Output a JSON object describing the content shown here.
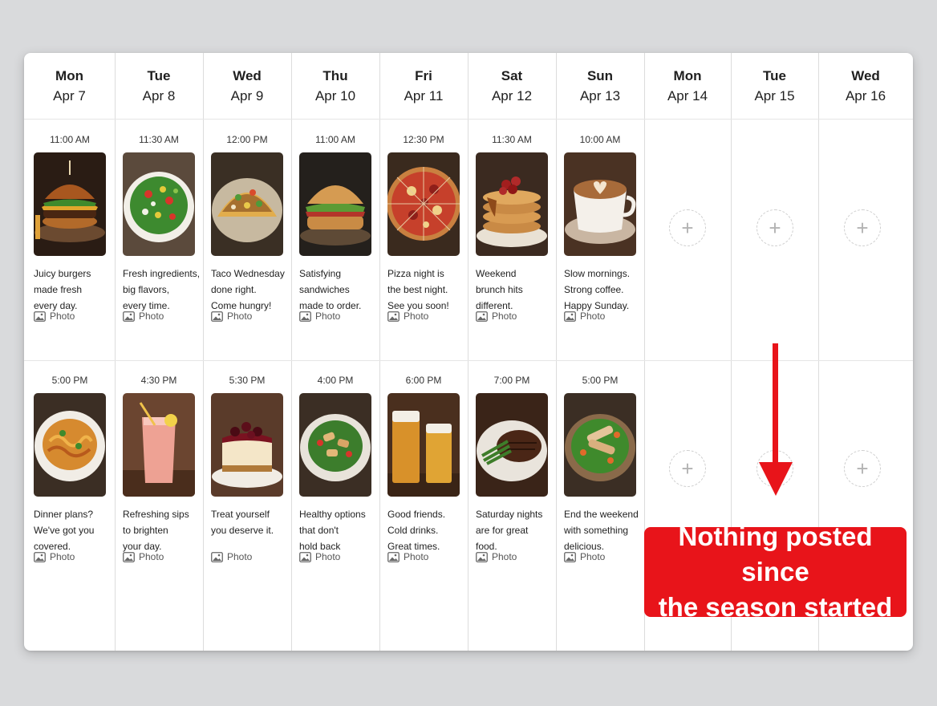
{
  "days": [
    {
      "dow": "Mon",
      "date": "Apr 7"
    },
    {
      "dow": "Tue",
      "date": "Apr 8"
    },
    {
      "dow": "Wed",
      "date": "Apr 9"
    },
    {
      "dow": "Thu",
      "date": "Apr 10"
    },
    {
      "dow": "Fri",
      "date": "Apr 11"
    },
    {
      "dow": "Sat",
      "date": "Apr 12"
    },
    {
      "dow": "Sun",
      "date": "Apr 13"
    },
    {
      "dow": "Mon",
      "date": "Apr 14"
    },
    {
      "dow": "Tue",
      "date": "Apr 15"
    },
    {
      "dow": "Wed",
      "date": "Apr 16"
    }
  ],
  "posts_top": [
    {
      "time": "11:00 AM",
      "caption": "Juicy burgers\nmade fresh\nevery day.",
      "type": "Photo",
      "image": "burger"
    },
    {
      "time": "11:30 AM",
      "caption": "Fresh ingredients,\nbig flavors,\nevery time.",
      "type": "Photo",
      "image": "salad"
    },
    {
      "time": "12:00 PM",
      "caption": "Taco Wednesday\ndone right.\nCome hungry!",
      "type": "Photo",
      "image": "tacos"
    },
    {
      "time": "11:00 AM",
      "caption": "Satisfying\nsandwiches\nmade to order.",
      "type": "Photo",
      "image": "sandwich"
    },
    {
      "time": "12:30 PM",
      "caption": "Pizza night is\nthe best night.\nSee you soon!",
      "type": "Photo",
      "image": "pizza"
    },
    {
      "time": "11:30 AM",
      "caption": "Weekend\nbrunch hits\ndifferent.",
      "type": "Photo",
      "image": "pancakes"
    },
    {
      "time": "10:00 AM",
      "caption": "Slow mornings.\nStrong coffee.\nHappy Sunday.",
      "type": "Photo",
      "image": "coffee"
    }
  ],
  "posts_bottom": [
    {
      "time": "5:00 PM",
      "caption": "Dinner plans?\nWe've got you\ncovered.",
      "type": "Photo",
      "image": "pasta"
    },
    {
      "time": "4:30 PM",
      "caption": "Refreshing sips\nto brighten\nyour day.",
      "type": "Photo",
      "image": "drink"
    },
    {
      "time": "5:30 PM",
      "caption": "Treat yourself\nyou deserve it.",
      "type": "Photo",
      "image": "cheesecake"
    },
    {
      "time": "4:00 PM",
      "caption": "Healthy options\nthat don't\nhold back",
      "type": "Photo",
      "image": "chicken-salad"
    },
    {
      "time": "6:00 PM",
      "caption": "Good friends.\nCold drinks.\nGreat times.",
      "type": "Photo",
      "image": "beers"
    },
    {
      "time": "7:00 PM",
      "caption": "Saturday nights\nare for great\nfood.",
      "type": "Photo",
      "image": "steak"
    },
    {
      "time": "5:00 PM",
      "caption": "End the weekend\nwith something\ndelicious.",
      "type": "Photo",
      "image": "grilled-salad"
    }
  ],
  "empty_slot": {
    "add_symbol": "+"
  },
  "callout": {
    "line1": "Nothing posted since",
    "line2": "the season started"
  },
  "colors": {
    "accent": "#e8141a",
    "background": "#d9dadc"
  }
}
